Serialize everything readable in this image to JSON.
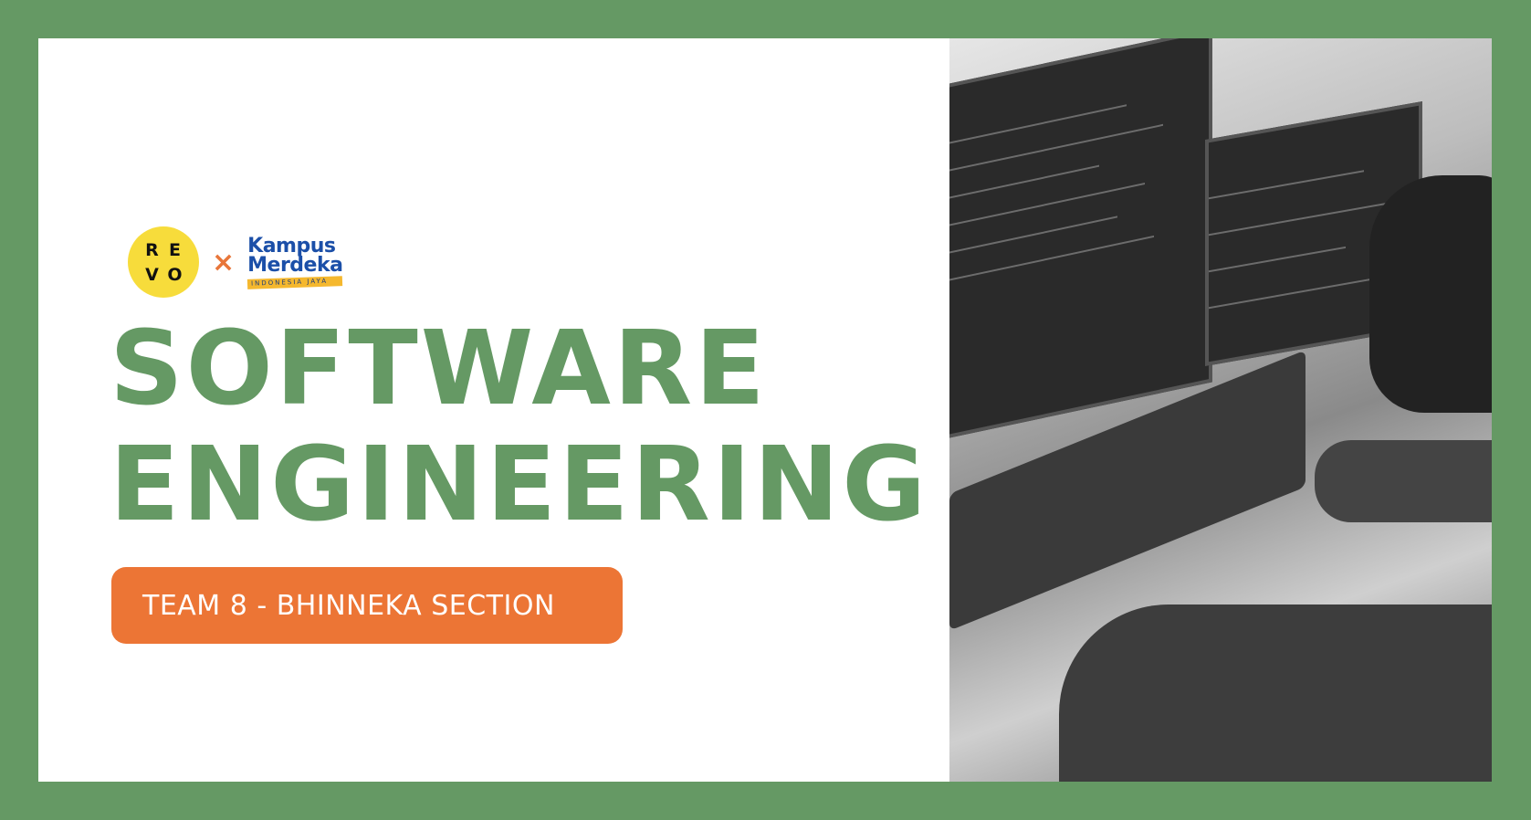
{
  "logos": {
    "revo_letters": [
      "R",
      "E",
      "V",
      "O"
    ],
    "separator": "×",
    "kampus_merdeka": {
      "line1": "Kampus",
      "line2": "Merdeka",
      "tagline": "INDONESIA JAYA"
    }
  },
  "title": {
    "line1": "SOFTWARE",
    "line2": "ENGINEERING"
  },
  "badge": {
    "label": "TEAM 8 - BHINNEKA SECTION"
  },
  "colors": {
    "frame": "#659964",
    "title": "#659964",
    "badge": "#ec7535",
    "revo": "#f7dc3b"
  },
  "photo": {
    "icon": "person-typing-at-computer-photo"
  }
}
